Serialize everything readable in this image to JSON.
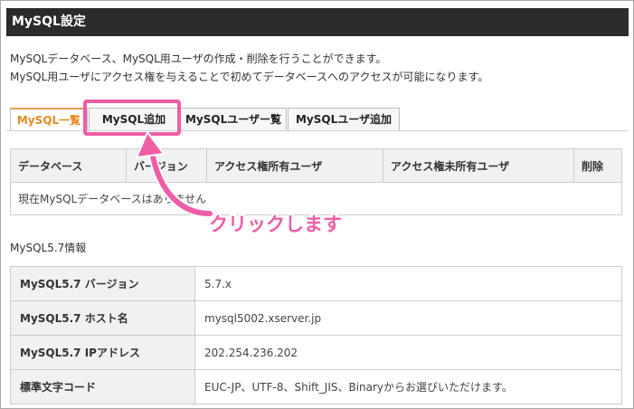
{
  "panel": {
    "title": "MySQL設定",
    "description_line1": "MySQLデータベース、MySQL用ユーザの作成・削除を行うことができます。",
    "description_line2": "MySQL用ユーザにアクセス権を与えることで初めてデータベースへのアクセスが可能になります。"
  },
  "tabs": [
    {
      "label": "MySQL一覧",
      "active": true
    },
    {
      "label": "MySQL追加",
      "active": false
    },
    {
      "label": "MySQLユーザー覧",
      "active": false
    },
    {
      "label": "MySQLユーザ追加",
      "active": false
    }
  ],
  "db_table": {
    "headers": [
      "データベース",
      "バージョン",
      "アクセス権所有ユーザ",
      "アクセス権未所有ユーザ",
      "削除"
    ],
    "empty_message": "現在MySQLデータベースはありません"
  },
  "info_section": {
    "label": "MySQL5.7情報",
    "rows": [
      {
        "label": "MySQL5.7 バージョン",
        "value": "5.7.x"
      },
      {
        "label": "MySQL5.7 ホスト名",
        "value": "mysql5002.xserver.jp"
      },
      {
        "label": "MySQL5.7 IPアドレス",
        "value": "202.254.236.202"
      },
      {
        "label": "標準文字コード",
        "value": "EUC-JP、UTF-8、Shift_JIS、Binaryからお選びいただけます。"
      }
    ]
  },
  "annotation": {
    "callout": "クリックします",
    "color": "#ef5da6"
  },
  "colors": {
    "title_bar": "#2b2b2b",
    "active_tab_text": "#e58a1f",
    "header_bg": "#f1f1f1"
  }
}
